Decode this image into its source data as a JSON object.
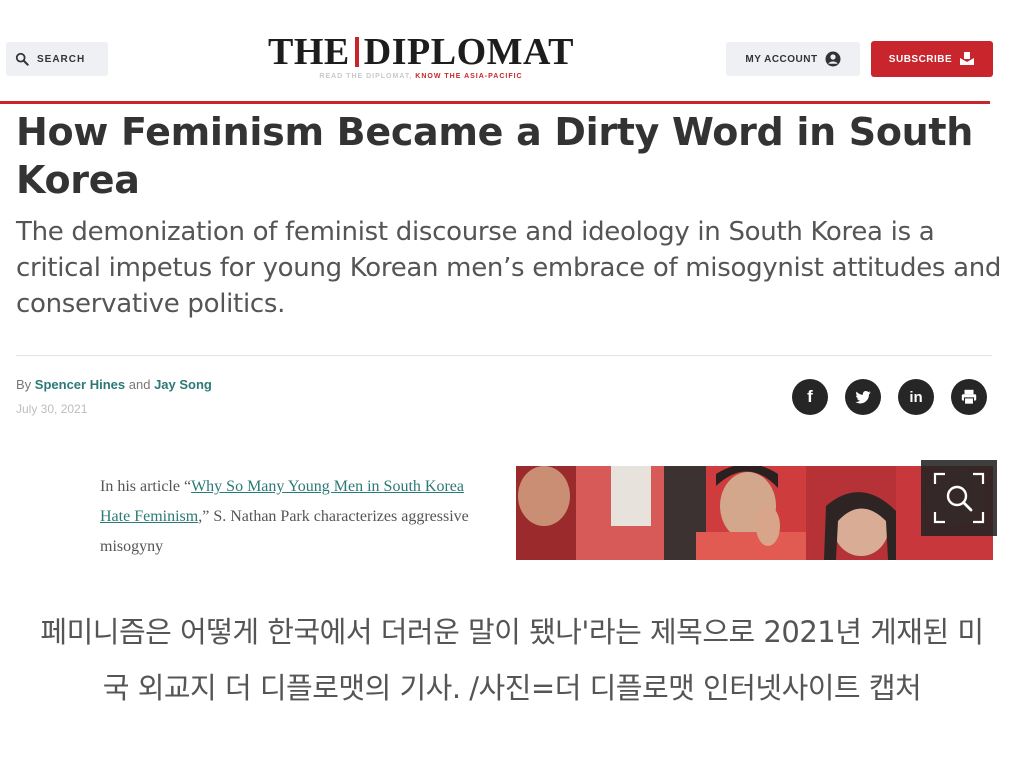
{
  "header": {
    "search_label": "SEARCH",
    "logo_left": "THE",
    "logo_right": "DIPLOMAT",
    "tagline_grey": "READ THE DIPLOMAT,",
    "tagline_red": "KNOW THE ASIA-PACIFIC",
    "account_label": "MY ACCOUNT",
    "subscribe_label": "SUBSCRIBE"
  },
  "article": {
    "title": "How Feminism Became a Dirty Word in South Korea",
    "dek": "The demonization of feminist discourse and ideology in South Korea is a critical impetus for young Korean men’s embrace of misogynist attitudes and conservative politics.",
    "by_prefix": "By",
    "author_1": "Spencer Hines",
    "and_word": "and",
    "author_2": "Jay Song",
    "date": "July 30, 2021",
    "excerpt_1": "In his article “",
    "excerpt_link": "Why So Many Young Men in South Korea Hate Feminism",
    "excerpt_2": ",” S. Nathan Park characterizes aggressive misogyny"
  },
  "social": {
    "facebook_glyph": "f",
    "linkedin_glyph": "in"
  },
  "caption": "페미니즘은 어떻게 한국에서 더러운 말이 됐나'라는 제목으로 2021년 게재된 미국 외교지 더 디플로맷의 기사. /사진=더 디플로맷 인터넷사이트 캡처",
  "colors": {
    "accent_red": "#c9252c",
    "author_teal": "#2b7a76",
    "icon_dark": "#262626"
  },
  "icons": [
    "search-icon",
    "account-icon",
    "subscribe-icon",
    "facebook-icon",
    "twitter-icon",
    "linkedin-icon",
    "print-icon",
    "zoom-icon"
  ]
}
